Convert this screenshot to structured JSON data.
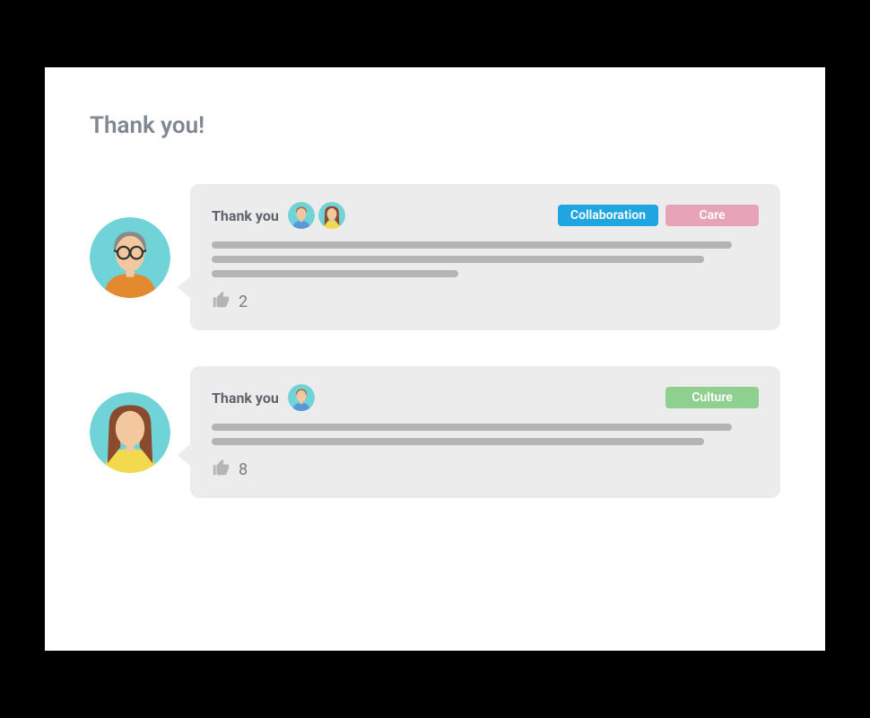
{
  "title": "Thank you!",
  "colors": {
    "card_bg": "#ececec",
    "line_gray": "#b4b4b4",
    "text_muted": "#808790",
    "avatar_bg": "#70d3d7",
    "tag_collaboration": "#1fa6e0",
    "tag_care": "#e7a3b7",
    "tag_culture": "#8fcf8f"
  },
  "posts": [
    {
      "author_avatar": "man-glasses",
      "thank_label": "Thank you",
      "recipients": [
        "man",
        "woman-brown"
      ],
      "tags": [
        {
          "label": "Collaboration",
          "color_key": "tag_collaboration"
        },
        {
          "label": "Care",
          "color_key": "tag_care"
        }
      ],
      "body_line_widths_pct": [
        95,
        90,
        45
      ],
      "likes": 2
    },
    {
      "author_avatar": "woman-brown",
      "thank_label": "Thank you",
      "recipients": [
        "man"
      ],
      "tags": [
        {
          "label": "Culture",
          "color_key": "tag_culture"
        }
      ],
      "body_line_widths_pct": [
        95,
        90
      ],
      "likes": 8
    }
  ],
  "avatars": {
    "man-glasses": {
      "bg": "#70d3d7",
      "skin": "#f4c89e",
      "hair": "#8a8a8a",
      "shirt": "#e38a2e",
      "glasses": true
    },
    "man": {
      "bg": "#70d3d7",
      "skin": "#f4c89e",
      "hair": "#a0744a",
      "shirt": "#5a99d6",
      "glasses": false
    },
    "woman-brown": {
      "bg": "#70d3d7",
      "skin": "#f4c89e",
      "hair": "#8a4a2e",
      "shirt": "#f2d94e",
      "glasses": false,
      "long_hair": true
    }
  }
}
